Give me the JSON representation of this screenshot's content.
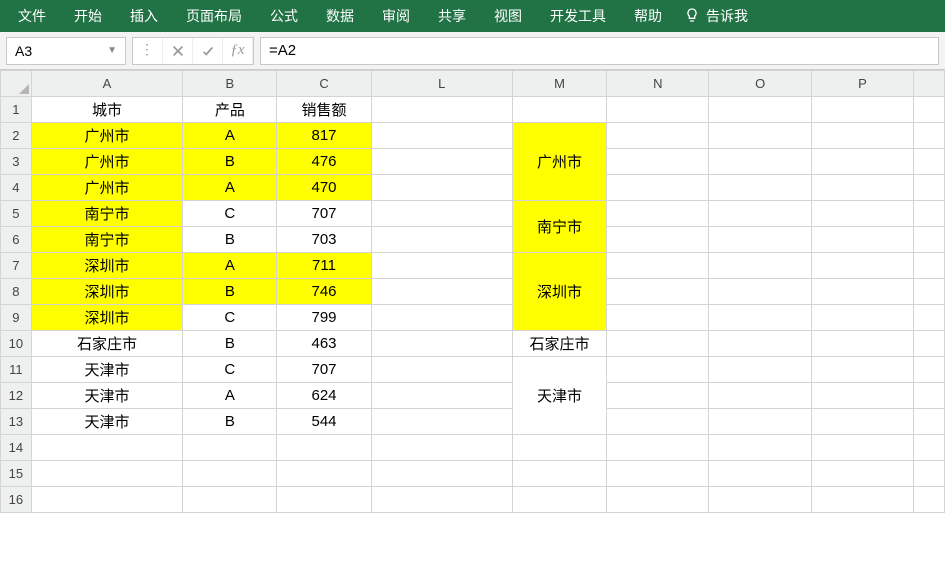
{
  "ribbon": {
    "tabs": [
      "文件",
      "开始",
      "插入",
      "页面布局",
      "公式",
      "数据",
      "审阅",
      "共享",
      "视图",
      "开发工具",
      "帮助"
    ],
    "tell_me": "告诉我"
  },
  "formula_bar": {
    "name_box": "A3",
    "formula": "=A2"
  },
  "columns": [
    "A",
    "B",
    "C",
    "L",
    "M",
    "N",
    "O",
    "P"
  ],
  "row_count": 16,
  "headers": {
    "A": "城市",
    "B": "产品",
    "C": "销售额"
  },
  "rows": [
    {
      "A": "广州市",
      "B": "A",
      "C": "817",
      "ay": true,
      "by": true,
      "cy": true
    },
    {
      "A": "广州市",
      "B": "B",
      "C": "476",
      "ay": true,
      "by": true,
      "cy": true
    },
    {
      "A": "广州市",
      "B": "A",
      "C": "470",
      "ay": true,
      "by": true,
      "cy": true
    },
    {
      "A": "南宁市",
      "B": "C",
      "C": "707",
      "ay": true,
      "by": false,
      "cy": false
    },
    {
      "A": "南宁市",
      "B": "B",
      "C": "703",
      "ay": true,
      "by": false,
      "cy": false
    },
    {
      "A": "深圳市",
      "B": "A",
      "C": "711",
      "ay": true,
      "by": true,
      "cy": true
    },
    {
      "A": "深圳市",
      "B": "B",
      "C": "746",
      "ay": true,
      "by": true,
      "cy": true
    },
    {
      "A": "深圳市",
      "B": "C",
      "C": "799",
      "ay": true,
      "by": false,
      "cy": false
    },
    {
      "A": "石家庄市",
      "B": "B",
      "C": "463",
      "ay": false,
      "by": false,
      "cy": false
    },
    {
      "A": "天津市",
      "B": "C",
      "C": "707",
      "ay": false,
      "by": false,
      "cy": false
    },
    {
      "A": "天津市",
      "B": "A",
      "C": "624",
      "ay": false,
      "by": false,
      "cy": false
    },
    {
      "A": "天津市",
      "B": "B",
      "C": "544",
      "ay": false,
      "by": false,
      "cy": false
    }
  ],
  "groups": [
    {
      "label": "广州市",
      "span": 3,
      "yellow": true
    },
    {
      "label": "南宁市",
      "span": 2,
      "yellow": true
    },
    {
      "label": "深圳市",
      "span": 3,
      "yellow": true
    },
    {
      "label": "石家庄市",
      "span": 1,
      "yellow": false
    },
    {
      "label": "天津市",
      "span": 3,
      "yellow": false
    }
  ]
}
